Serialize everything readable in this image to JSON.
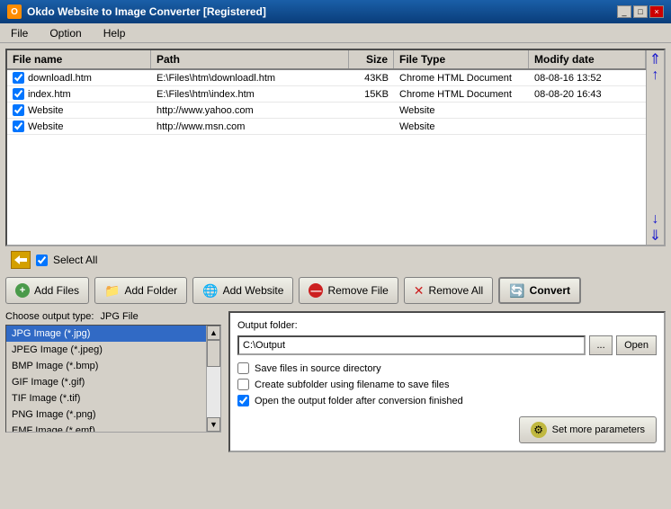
{
  "titleBar": {
    "title": "Okdo Website to Image Converter [Registered]",
    "icon": "O",
    "controls": [
      "_",
      "□",
      "×"
    ]
  },
  "menuBar": {
    "items": [
      "File",
      "Option",
      "Help"
    ]
  },
  "fileTable": {
    "columns": [
      "File name",
      "Path",
      "Size",
      "File Type",
      "Modify date"
    ],
    "rows": [
      {
        "checked": true,
        "name": "downloadl.htm",
        "path": "E:\\Files\\htm\\downloadl.htm",
        "size": "43KB",
        "type": "Chrome HTML Document",
        "date": "08-08-16 13:52"
      },
      {
        "checked": true,
        "name": "index.htm",
        "path": "E:\\Files\\htm\\index.htm",
        "size": "15KB",
        "type": "Chrome HTML Document",
        "date": "08-08-20 16:43"
      },
      {
        "checked": true,
        "name": "Website",
        "path": "http://www.yahoo.com",
        "size": "",
        "type": "Website",
        "date": ""
      },
      {
        "checked": true,
        "name": "Website",
        "path": "http://www.msn.com",
        "size": "",
        "type": "Website",
        "date": ""
      }
    ]
  },
  "selectAll": {
    "checked": true,
    "label": "Select All"
  },
  "toolbar": {
    "addFiles": "Add Files",
    "addFolder": "Add Folder",
    "addWebsite": "Add Website",
    "removeFile": "Remove File",
    "removeAll": "Remove All",
    "convert": "Convert"
  },
  "outputType": {
    "label": "Choose output type:",
    "selected": "JPG File",
    "items": [
      "JPG Image (*.jpg)",
      "JPEG Image (*.jpeg)",
      "BMP Image (*.bmp)",
      "GIF Image (*.gif)",
      "TIF Image (*.tif)",
      "PNG Image (*.png)",
      "EMF Image (*.emf)"
    ]
  },
  "outputFolder": {
    "label": "Output folder:",
    "path": "C:\\Output",
    "browseBtnLabel": "...",
    "openBtnLabel": "Open",
    "options": [
      {
        "checked": false,
        "label": "Save files in source directory"
      },
      {
        "checked": false,
        "label": "Create subfolder using filename to save files"
      },
      {
        "checked": true,
        "label": "Open the output folder after conversion finished"
      }
    ],
    "setParamsBtn": "Set more parameters"
  }
}
